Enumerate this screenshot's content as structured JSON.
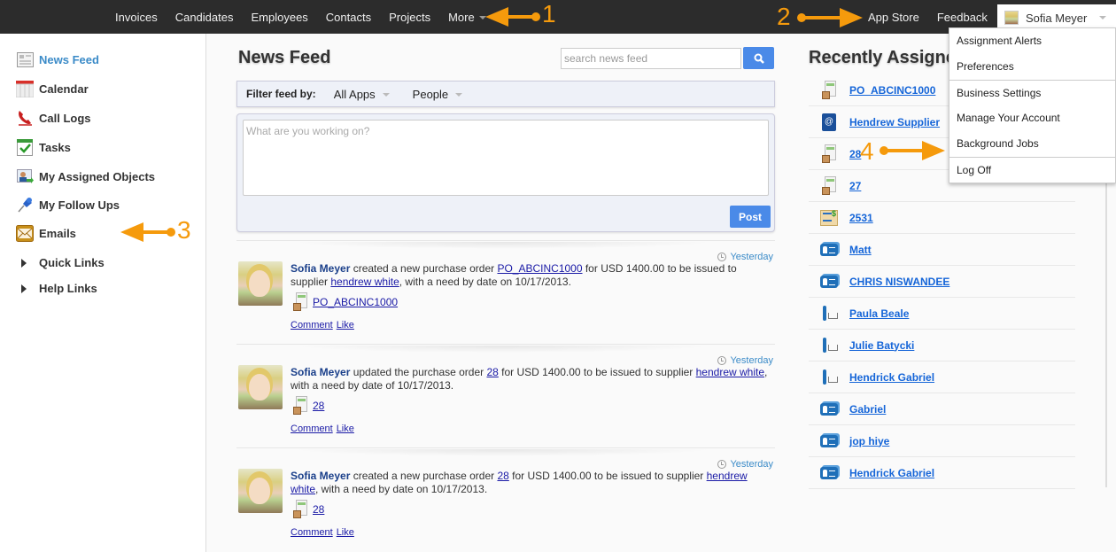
{
  "topnav": {
    "items": [
      "Invoices",
      "Candidates",
      "Employees",
      "Contacts",
      "Projects",
      "More"
    ],
    "right_items": [
      "App Store",
      "Feedback"
    ],
    "user_name": "Sofia Meyer"
  },
  "user_dropdown": {
    "items": [
      "Assignment Alerts",
      "Preferences",
      "Business Settings",
      "Manage Your Account",
      "Background Jobs",
      "Log Off"
    ]
  },
  "sidebar": {
    "items": [
      {
        "label": "News Feed",
        "icon": "newspaper-icon",
        "active": true
      },
      {
        "label": "Calendar",
        "icon": "calendar-icon"
      },
      {
        "label": "Call Logs",
        "icon": "phone-icon"
      },
      {
        "label": "Tasks",
        "icon": "tasks-check-icon"
      },
      {
        "label": "My Assigned Objects",
        "icon": "assigned-user-icon"
      },
      {
        "label": "My Follow Ups",
        "icon": "pushpin-icon"
      },
      {
        "label": "Emails",
        "icon": "envelope-icon"
      }
    ],
    "groups": [
      "Quick Links",
      "Help Links"
    ]
  },
  "main": {
    "title": "News Feed",
    "search_placeholder": "search news feed",
    "filter_label": "Filter feed by:",
    "filter_apps": "All Apps",
    "filter_people": "People",
    "composer_placeholder": "What are you working on?",
    "post_label": "Post",
    "posts": [
      {
        "time": "Yesterday",
        "author": "Sofia Meyer",
        "t1": " created a new purchase order ",
        "link1": "PO_ABCINC1000",
        "t2": " for USD 1400.00 to be issued to supplier ",
        "link2": "hendrew white",
        "t3": ", with a need by date on 10/17/2013.",
        "object": "PO_ABCINC1000",
        "comment": "Comment",
        "like": "Like"
      },
      {
        "time": "Yesterday",
        "author": "Sofia Meyer",
        "t1": " updated the purchase order ",
        "link1": "28",
        "t2": " for USD 1400.00 to be issued to supplier ",
        "link2": "hendrew white",
        "t3": ", with a need by date of 10/17/2013.",
        "object": "28",
        "comment": "Comment",
        "like": "Like"
      },
      {
        "time": "Yesterday",
        "author": "Sofia Meyer",
        "t1": " created a new purchase order ",
        "link1": "28",
        "t2": " for USD 1400.00 to be issued to supplier ",
        "link2": "hendrew white",
        "t3": ", with a need by date on 10/17/2013.",
        "object": "28",
        "comment": "Comment",
        "like": "Like"
      }
    ]
  },
  "recent": {
    "title": "Recently Assigned",
    "items": [
      {
        "label": "PO_ABCINC1000",
        "icon": "purchase-order-icon"
      },
      {
        "label": "Hendrew Supplier",
        "icon": "address-book-icon"
      },
      {
        "label": "28",
        "icon": "purchase-order-icon"
      },
      {
        "label": "27",
        "icon": "purchase-order-icon"
      },
      {
        "label": "2531",
        "icon": "invoice-envelope-icon"
      },
      {
        "label": "Matt",
        "icon": "contact-card-icon"
      },
      {
        "label": "CHRIS NISWANDEE",
        "icon": "contact-card-icon"
      },
      {
        "label": "Paula Beale",
        "icon": "shopper-icon"
      },
      {
        "label": "Julie Batycki",
        "icon": "shopper-icon"
      },
      {
        "label": "Hendrick Gabriel",
        "icon": "shopper-icon"
      },
      {
        "label": "Gabriel",
        "icon": "contact-card-icon"
      },
      {
        "label": "jop hiye",
        "icon": "contact-card-icon"
      },
      {
        "label": "Hendrick Gabriel",
        "icon": "contact-card-icon"
      }
    ]
  },
  "annotations": [
    "1",
    "2",
    "3",
    "4"
  ],
  "colors": {
    "accent": "#4a8ae8",
    "annotation": "#f59a0c",
    "topbar": "#2c2c2c",
    "link": "#1565d8"
  }
}
